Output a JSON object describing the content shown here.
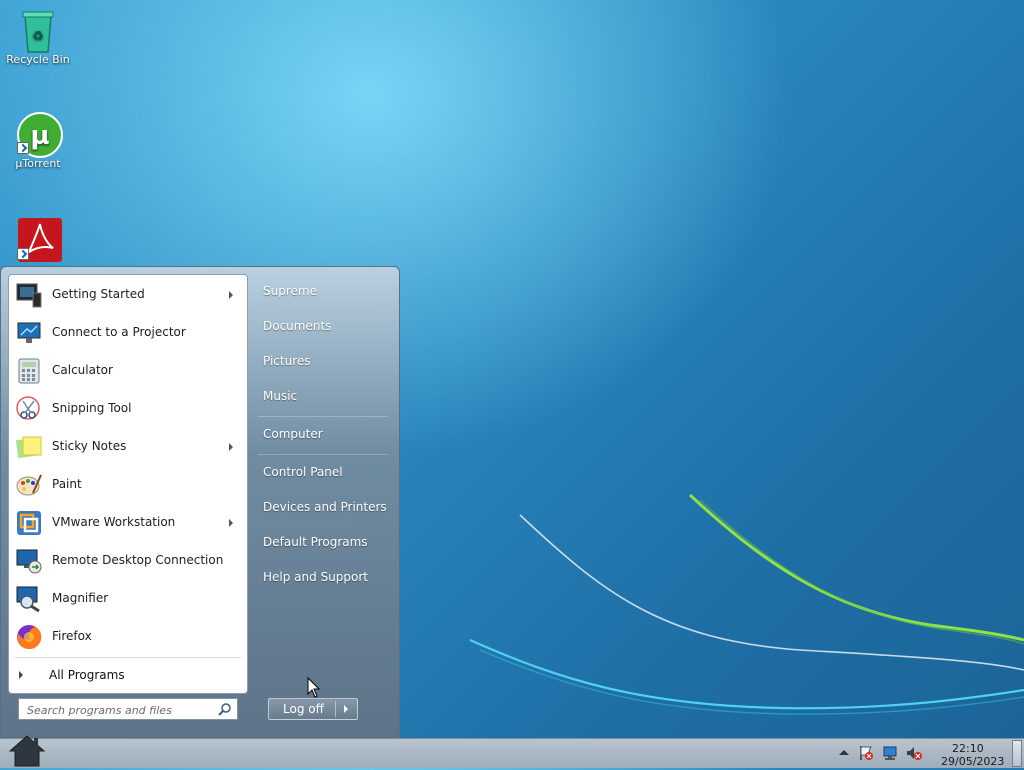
{
  "desktop": {
    "icons": [
      {
        "label": "Recycle Bin"
      },
      {
        "label": "µTorrent"
      },
      {
        "label": ""
      }
    ]
  },
  "start_menu": {
    "programs": [
      {
        "label": "Getting Started",
        "has_submenu": true,
        "icon": "getting-started-icon"
      },
      {
        "label": "Connect to a Projector",
        "has_submenu": false,
        "icon": "projector-icon"
      },
      {
        "label": "Calculator",
        "has_submenu": false,
        "icon": "calculator-icon"
      },
      {
        "label": "Snipping Tool",
        "has_submenu": false,
        "icon": "scissors-icon"
      },
      {
        "label": "Sticky Notes",
        "has_submenu": true,
        "icon": "sticky-notes-icon"
      },
      {
        "label": "Paint",
        "has_submenu": false,
        "icon": "paint-palette-icon"
      },
      {
        "label": "VMware Workstation",
        "has_submenu": true,
        "icon": "vmware-icon"
      },
      {
        "label": "Remote Desktop Connection",
        "has_submenu": false,
        "icon": "remote-desktop-icon"
      },
      {
        "label": "Magnifier",
        "has_submenu": false,
        "icon": "magnifier-icon"
      },
      {
        "label": "Firefox",
        "has_submenu": false,
        "icon": "firefox-icon"
      }
    ],
    "all_programs_label": "All Programs",
    "search_placeholder": "Search programs and files",
    "places": [
      {
        "label": "Supreme"
      },
      {
        "label": "Documents"
      },
      {
        "label": "Pictures"
      },
      {
        "label": "Music"
      },
      {
        "label": "Computer"
      },
      {
        "label": "Control Panel"
      },
      {
        "label": "Devices and Printers"
      },
      {
        "label": "Default Programs"
      },
      {
        "label": "Help and Support"
      }
    ],
    "logoff_label": "Log off"
  },
  "taskbar": {
    "clock_time": "22:10",
    "clock_date": "29/05/2023",
    "tray_icons": [
      "show-hidden-icons-chevron",
      "action-center-flag-icon",
      "network-icon",
      "volume-muted-icon"
    ]
  },
  "colors": {
    "desktop_accent": "#2a86bd",
    "swoosh_green": "#7ed34a"
  }
}
